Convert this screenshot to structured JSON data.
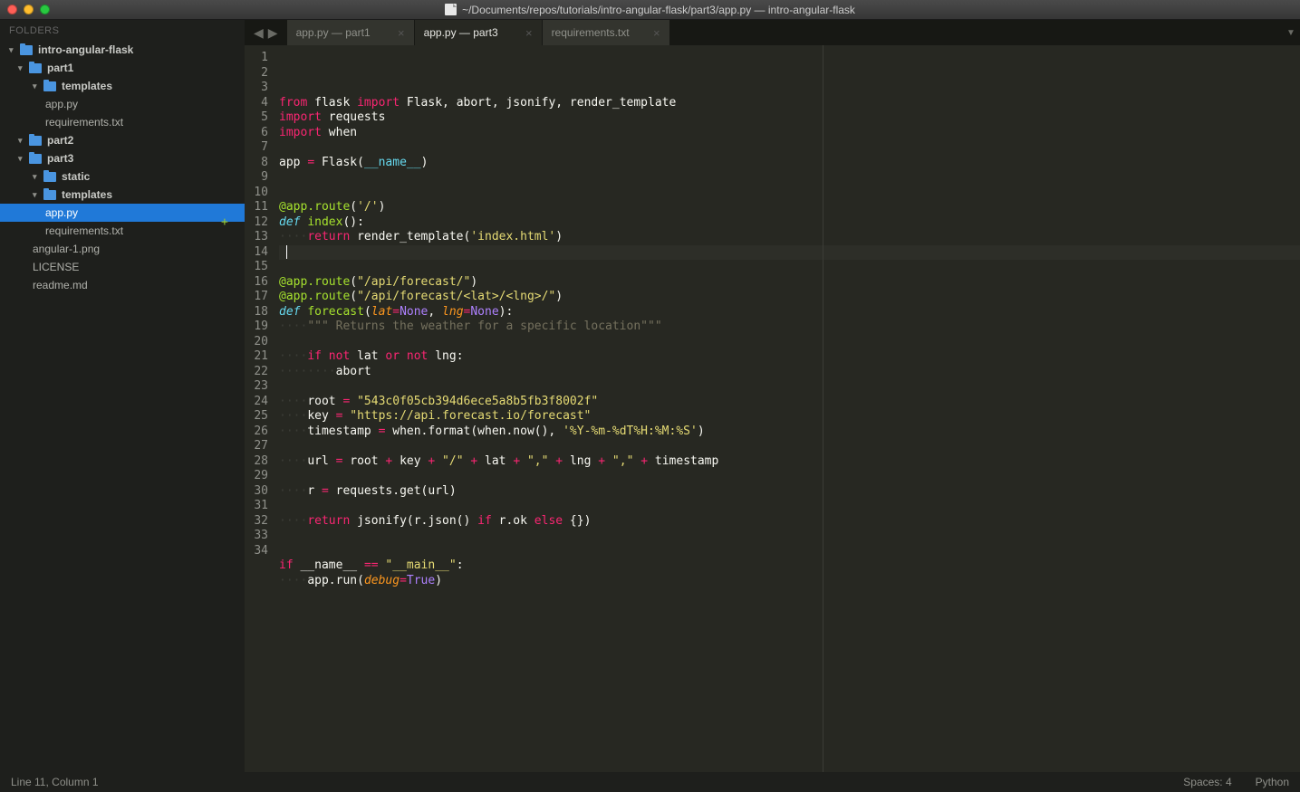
{
  "window": {
    "title": "~/Documents/repos/tutorials/intro-angular-flask/part3/app.py — intro-angular-flask"
  },
  "sidebar": {
    "header": "FOLDERS",
    "tree": [
      {
        "type": "folder",
        "label": "intro-angular-flask",
        "indent": 0
      },
      {
        "type": "folder",
        "label": "part1",
        "indent": 1
      },
      {
        "type": "folder",
        "label": "templates",
        "indent": 2
      },
      {
        "type": "file",
        "label": "app.py",
        "indent": 3
      },
      {
        "type": "file",
        "label": "requirements.txt",
        "indent": 3
      },
      {
        "type": "folder",
        "label": "part2",
        "indent": 1
      },
      {
        "type": "folder",
        "label": "part3",
        "indent": 1
      },
      {
        "type": "folder",
        "label": "static",
        "indent": 2
      },
      {
        "type": "folder",
        "label": "templates",
        "indent": 2
      },
      {
        "type": "file",
        "label": "app.py",
        "indent": 3,
        "selected": true
      },
      {
        "type": "file",
        "label": "requirements.txt",
        "indent": 3
      },
      {
        "type": "file",
        "label": "angular-1.png",
        "indent": 2
      },
      {
        "type": "file",
        "label": "LICENSE",
        "indent": 2
      },
      {
        "type": "file",
        "label": "readme.md",
        "indent": 2
      }
    ]
  },
  "tabs": [
    {
      "label": "app.py — part1",
      "active": false
    },
    {
      "label": "app.py — part3",
      "active": true
    },
    {
      "label": "requirements.txt",
      "active": false
    }
  ],
  "code_lines": [
    {
      "n": 1,
      "html": "<span class='kw2'>from</span> flask <span class='kw2'>import</span> Flask, abort, jsonify, render_template"
    },
    {
      "n": 2,
      "html": "<span class='kw2'>import</span> requests"
    },
    {
      "n": 3,
      "html": "<span class='kw2'>import</span> when"
    },
    {
      "n": 4,
      "html": ""
    },
    {
      "n": 5,
      "html": "app <span class='op'>=</span> Flask(<span class='builtin'>__name__</span>)"
    },
    {
      "n": 6,
      "html": ""
    },
    {
      "n": 7,
      "html": ""
    },
    {
      "n": 8,
      "html": "<span class='dec'>@app.route</span>(<span class='str'>'/'</span>)"
    },
    {
      "n": 9,
      "html": "<span class='fn'>def</span> <span class='cls'>index</span>():"
    },
    {
      "n": 10,
      "html": "<span class='ws'>····</span><span class='kw2'>return</span> render_template(<span class='str'>'index.html'</span>)"
    },
    {
      "n": 11,
      "html": "",
      "cursor": true
    },
    {
      "n": 12,
      "html": "",
      "marker": "+"
    },
    {
      "n": 13,
      "html": "<span class='dec'>@app.route</span>(<span class='str'>\"/api/forecast/\"</span>)"
    },
    {
      "n": 14,
      "html": "<span class='dec'>@app.route</span>(<span class='str'>\"/api/forecast/&lt;lat&gt;/&lt;lng&gt;/\"</span>)"
    },
    {
      "n": 15,
      "html": "<span class='fn'>def</span> <span class='cls'>forecast</span>(<span class='param'>lat</span><span class='op'>=</span><span class='num'>None</span>, <span class='param'>lng</span><span class='op'>=</span><span class='num'>None</span>):"
    },
    {
      "n": 16,
      "html": "<span class='ws'>····</span><span class='cmt'>\"\"\" Returns the weather for a specific location\"\"\"</span>"
    },
    {
      "n": 17,
      "html": ""
    },
    {
      "n": 18,
      "html": "<span class='ws'>····</span><span class='kw2'>if</span> <span class='kw2'>not</span> lat <span class='kw2'>or</span> <span class='kw2'>not</span> lng:"
    },
    {
      "n": 19,
      "html": "<span class='ws'>········</span>abort"
    },
    {
      "n": 20,
      "html": ""
    },
    {
      "n": 21,
      "html": "<span class='ws'>····</span>root <span class='op'>=</span> <span class='str'>\"543c0f05cb394d6ece5a8b5fb3f8002f\"</span>"
    },
    {
      "n": 22,
      "html": "<span class='ws'>····</span>key <span class='op'>=</span> <span class='str'>\"https://api.forecast.io/forecast\"</span>"
    },
    {
      "n": 23,
      "html": "<span class='ws'>····</span>timestamp <span class='op'>=</span> when.format(when.now(), <span class='str'>'%Y-%m-%dT%H:%M:%S'</span>)"
    },
    {
      "n": 24,
      "html": ""
    },
    {
      "n": 25,
      "html": "<span class='ws'>····</span>url <span class='op'>=</span> root <span class='op'>+</span> key <span class='op'>+</span> <span class='str'>\"/\"</span> <span class='op'>+</span> lat <span class='op'>+</span> <span class='str'>\",\"</span> <span class='op'>+</span> lng <span class='op'>+</span> <span class='str'>\",\"</span> <span class='op'>+</span> timestamp"
    },
    {
      "n": 26,
      "html": ""
    },
    {
      "n": 27,
      "html": "<span class='ws'>····</span>r <span class='op'>=</span> requests.get(url)"
    },
    {
      "n": 28,
      "html": ""
    },
    {
      "n": 29,
      "html": "<span class='ws'>····</span><span class='kw2'>return</span> jsonify(r.json() <span class='kw2'>if</span> r.ok <span class='kw2'>else</span> {})"
    },
    {
      "n": 30,
      "html": ""
    },
    {
      "n": 31,
      "html": ""
    },
    {
      "n": 32,
      "html": "<span class='kw2'>if</span> __name__ <span class='op'>==</span> <span class='str'>\"__main__\"</span>:"
    },
    {
      "n": 33,
      "html": "<span class='ws'>····</span>app.run(<span class='param'>debug</span><span class='op'>=</span><span class='num'>True</span>)"
    },
    {
      "n": 34,
      "html": ""
    }
  ],
  "status": {
    "left": "Line 11, Column 1",
    "spaces": "Spaces: 4",
    "lang": "Python"
  }
}
